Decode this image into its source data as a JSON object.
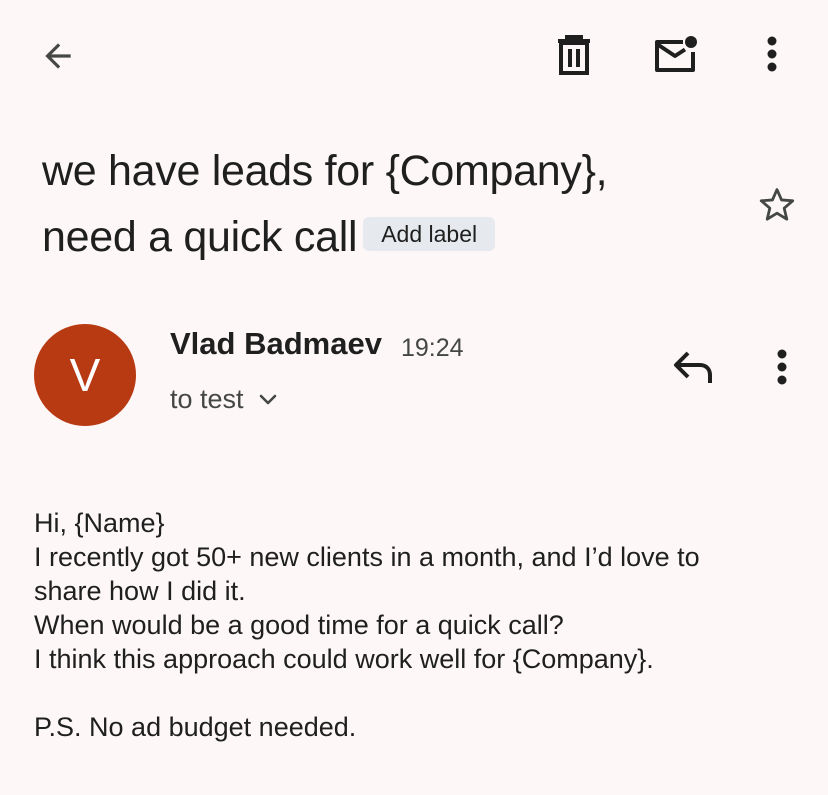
{
  "toolbar": {
    "back_icon": "arrow-left-icon",
    "delete_icon": "trash-icon",
    "mark_unread_icon": "mail-unread-icon",
    "more_icon": "more-vert-icon"
  },
  "subject": {
    "line1": "we have leads for {Company},",
    "line2": "need a quick call",
    "add_label": "Add label",
    "star_icon": "star-outline-icon"
  },
  "message": {
    "avatar_letter": "V",
    "avatar_color": "#b83a12",
    "sender_name": "Vlad Badmaev",
    "time": "19:24",
    "recipient": "to test",
    "reply_icon": "reply-icon",
    "more_icon": "more-vert-icon",
    "body": [
      "Hi, {Name}",
      "I recently got 50+ new clients in a month, and I’d love to",
      "share how I did it.",
      "When would be a good time for a quick call?",
      "I think this approach could work well for {Company}.",
      "",
      "P.S. No ad budget needed."
    ]
  },
  "colors": {
    "background": "#fdf7f7",
    "text": "#1f1f1f",
    "secondary_text": "#444746",
    "chip_bg": "#e6e9ee"
  }
}
